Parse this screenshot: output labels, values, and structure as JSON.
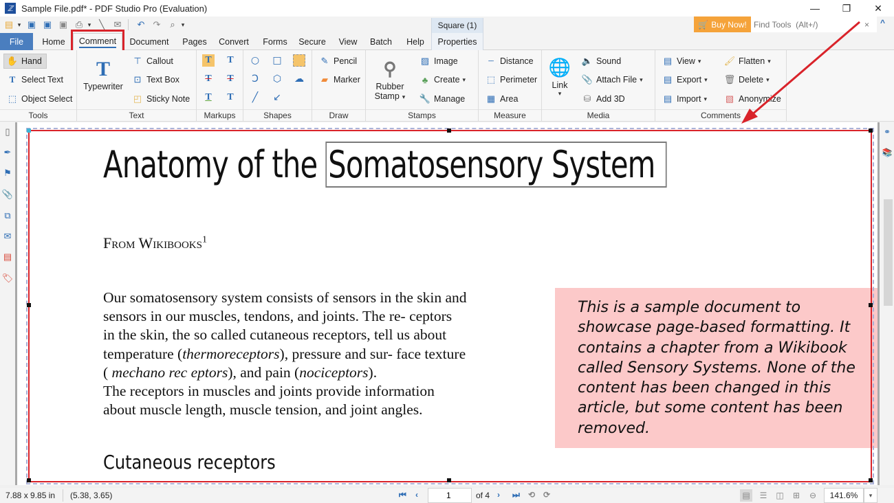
{
  "window": {
    "title": "Sample File.pdf* - PDF Studio Pro (Evaluation)",
    "controls": {
      "minimize": "—",
      "restore": "❐",
      "close": "✕"
    }
  },
  "quick_access": {
    "icons": [
      "open-icon",
      "save-icon",
      "save-as-icon",
      "save-all-icon",
      "print-icon",
      "scan-icon",
      "email-icon",
      "undo-icon",
      "redo-icon",
      "zoom-page-icon"
    ]
  },
  "topbar": {
    "buy_now": "Buy Now!",
    "find_tools_placeholder": "Find Tools  (Alt+/)",
    "find_clear": "×",
    "collapse": "^"
  },
  "tabs": {
    "items": [
      {
        "label": "File"
      },
      {
        "label": "Home"
      },
      {
        "label": "Comment",
        "active": true
      },
      {
        "label": "Document"
      },
      {
        "label": "Pages"
      },
      {
        "label": "Convert"
      },
      {
        "label": "Forms"
      },
      {
        "label": "Secure"
      },
      {
        "label": "View"
      },
      {
        "label": "Batch"
      },
      {
        "label": "Help"
      },
      {
        "label": "Properties"
      }
    ],
    "contextual_label": "Square (1)"
  },
  "ribbon": {
    "groups": {
      "tools": {
        "label": "Tools",
        "items": [
          "Hand",
          "Select Text",
          "Object Select"
        ]
      },
      "text": {
        "label": "Text",
        "typewriter": "Typewriter",
        "items": [
          "Callout",
          "Text Box",
          "Sticky Note"
        ]
      },
      "markups": {
        "label": "Markups"
      },
      "shapes": {
        "label": "Shapes"
      },
      "draw": {
        "label": "Draw",
        "items": [
          "Pencil",
          "Marker"
        ]
      },
      "stamps": {
        "label": "Stamps",
        "rubber_stamp_1": "Rubber",
        "rubber_stamp_2": "Stamp",
        "items": [
          "Image",
          "Create",
          "Manage"
        ]
      },
      "measure": {
        "label": "Measure",
        "items": [
          "Distance",
          "Perimeter",
          "Area"
        ]
      },
      "media": {
        "label": "Media",
        "link": "Link",
        "items": [
          "Sound",
          "Attach File",
          "Add 3D"
        ]
      },
      "comments": {
        "label": "Comments",
        "items": [
          "View",
          "Export",
          "Import",
          "Flatten",
          "Delete",
          "Anonymize"
        ]
      }
    }
  },
  "document": {
    "title_plain": "Anatomy of the ",
    "title_boxed": "Somatosensory System",
    "subtitle": "From Wikibooks",
    "subtitle_sup": "1",
    "body_lines": [
      "Our somatosensory system consists of  sensors in the skin  and",
      "sensors in our  muscles, tendons, and  joints. The re- ceptors",
      "in the skin, the so  called cutaneous receptors,  tell  us about"
    ],
    "line4": {
      "a": "temperature (",
      "b": "thermoreceptors",
      "c": "),  pressure and sur- face  texture"
    },
    "line5": {
      "a": "( ",
      "b": "mechano  rec  eptors",
      "c": "), and  pain  (",
      "d": "nociceptors",
      "e": ")."
    },
    "body_lines_2": [
      "The  receptors  in  muscles  and  joints  provide  information",
      "about muscle length, muscle   tension, and joint angles."
    ],
    "sidebox_lines": [
      "This is a sample document to",
      "showcase page-based formatting. It",
      "contains a chapter from a Wikibook",
      "called Sensory Systems. None of the",
      "content has been changed in this",
      "article, but some content has been",
      "removed."
    ],
    "section_heading": "Cutaneous receptors"
  },
  "statusbar": {
    "page_size": "7.88 x 9.85 in",
    "coordinates": "(5.38, 3.65)",
    "current_page": "1",
    "of_pages": "of 4",
    "zoom": "141.6%"
  },
  "colors": {
    "accent": "#2f6eb5",
    "file_tab": "#4a7ebf",
    "buy_now": "#f5a33a",
    "highlight_red": "#d9232a",
    "sidebox_pink": "#fcc9c9"
  }
}
